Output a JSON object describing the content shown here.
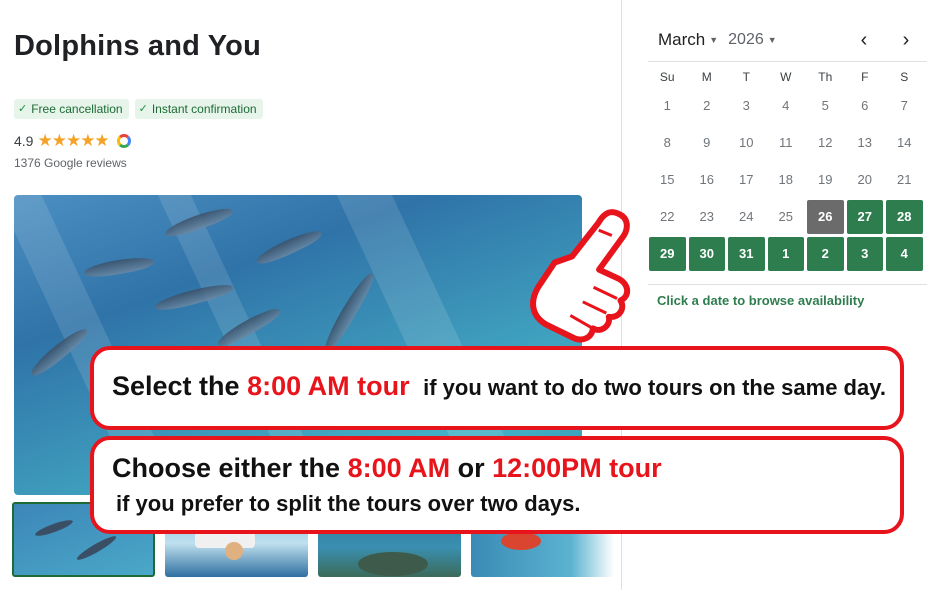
{
  "product": {
    "title": "Dolphins and You",
    "badges": [
      "Free cancellation",
      "Instant confirmation"
    ],
    "rating": "4.9",
    "stars": "★★★★★",
    "reviews": "1376 Google reviews"
  },
  "gallery": {
    "main_image": "dolphins-underwater-photo",
    "thumbnails": [
      "dolphins-underwater-thumb",
      "boat-slide-thumb",
      "sea-turtle-thumb",
      "snorkeler-thumb"
    ]
  },
  "calendar": {
    "month": "March",
    "year": "2026",
    "prev_icon": "chevron-left-icon",
    "next_icon": "chevron-right-icon",
    "weekdays": [
      "Su",
      "M",
      "T",
      "W",
      "Th",
      "F",
      "S"
    ],
    "days": [
      {
        "label": "1",
        "state": "disabled"
      },
      {
        "label": "2",
        "state": "disabled"
      },
      {
        "label": "3",
        "state": "disabled"
      },
      {
        "label": "4",
        "state": "disabled"
      },
      {
        "label": "5",
        "state": "disabled"
      },
      {
        "label": "6",
        "state": "disabled"
      },
      {
        "label": "7",
        "state": "disabled"
      },
      {
        "label": "8",
        "state": "disabled"
      },
      {
        "label": "9",
        "state": "disabled"
      },
      {
        "label": "10",
        "state": "disabled"
      },
      {
        "label": "11",
        "state": "disabled"
      },
      {
        "label": "12",
        "state": "disabled"
      },
      {
        "label": "13",
        "state": "disabled"
      },
      {
        "label": "14",
        "state": "disabled"
      },
      {
        "label": "15",
        "state": "disabled"
      },
      {
        "label": "16",
        "state": "disabled"
      },
      {
        "label": "17",
        "state": "disabled"
      },
      {
        "label": "18",
        "state": "disabled"
      },
      {
        "label": "19",
        "state": "disabled"
      },
      {
        "label": "20",
        "state": "disabled"
      },
      {
        "label": "21",
        "state": "disabled"
      },
      {
        "label": "22",
        "state": "disabled"
      },
      {
        "label": "23",
        "state": "disabled"
      },
      {
        "label": "24",
        "state": "disabled"
      },
      {
        "label": "25",
        "state": "disabled"
      },
      {
        "label": "26",
        "state": "today"
      },
      {
        "label": "27",
        "state": "available"
      },
      {
        "label": "28",
        "state": "available"
      },
      {
        "label": "29",
        "state": "available"
      },
      {
        "label": "30",
        "state": "available"
      },
      {
        "label": "31",
        "state": "available"
      },
      {
        "label": "1",
        "state": "available"
      },
      {
        "label": "2",
        "state": "available"
      },
      {
        "label": "3",
        "state": "available"
      },
      {
        "label": "4",
        "state": "available"
      }
    ],
    "hint": "Click a date to browse availability"
  },
  "callouts": {
    "first": {
      "prefix": "Select the",
      "highlight": "8:00 AM tour",
      "suffix": "if you want to do two tours on the same day."
    },
    "second": {
      "prefix": "Choose either the",
      "highlight_1": "8:00 AM",
      "connector": "or",
      "highlight_2": "12:00PM tour",
      "line2": "if you prefer to split the tours over two days."
    }
  },
  "colors": {
    "accent_green": "#2e7d4f",
    "today_gray": "#6b6b6b",
    "callout_red": "#e8141c"
  }
}
